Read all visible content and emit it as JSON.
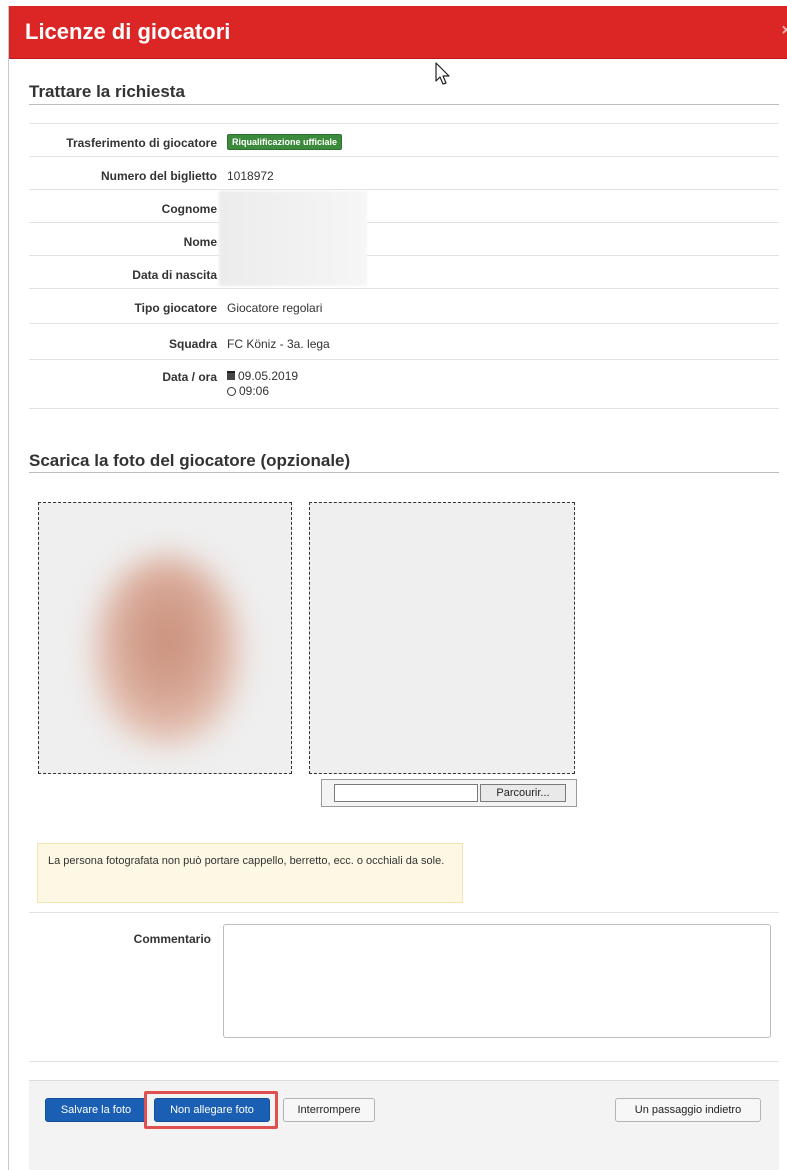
{
  "window": {
    "title": "Licenze di giocatori",
    "close_symbol": "×"
  },
  "request": {
    "section_title": "Trattare la richiesta",
    "rows": [
      {
        "label": "Trasferimento di giocatore",
        "badge": "Riqualificazione ufficiale"
      },
      {
        "label": "Numero del biglietto",
        "value": "1018972"
      },
      {
        "label": "Cognome",
        "value": ""
      },
      {
        "label": "Nome",
        "value": ""
      },
      {
        "label": "Data di nascita",
        "value": ""
      },
      {
        "label": "Tipo giocatore",
        "value": "Giocatore regolari"
      },
      {
        "label": "Squadra",
        "value": "FC Köniz - 3a. lega"
      },
      {
        "label": "Data / ora",
        "date": "09.05.2019",
        "time": "09:06",
        "date_icon": "calendar-icon",
        "time_icon": "clock-icon"
      }
    ]
  },
  "photo": {
    "section_title": "Scarica la foto del giocatore (opzionale)",
    "browse_label": "Parcourir...",
    "notice": "La persona fotografata non può portare cappello, berretto, ecc. o occhiali da sole."
  },
  "comment": {
    "label": "Commentario",
    "value": ""
  },
  "actions": {
    "save_photo": "Salvare la foto",
    "no_photo": "Non allegare foto",
    "cancel": "Interrompere",
    "back": "Un passaggio indietro"
  },
  "colors": {
    "header": "#dc2626",
    "primary": "#1a5fb4",
    "badge": "#3c8a3c",
    "highlight": "#e05050"
  }
}
